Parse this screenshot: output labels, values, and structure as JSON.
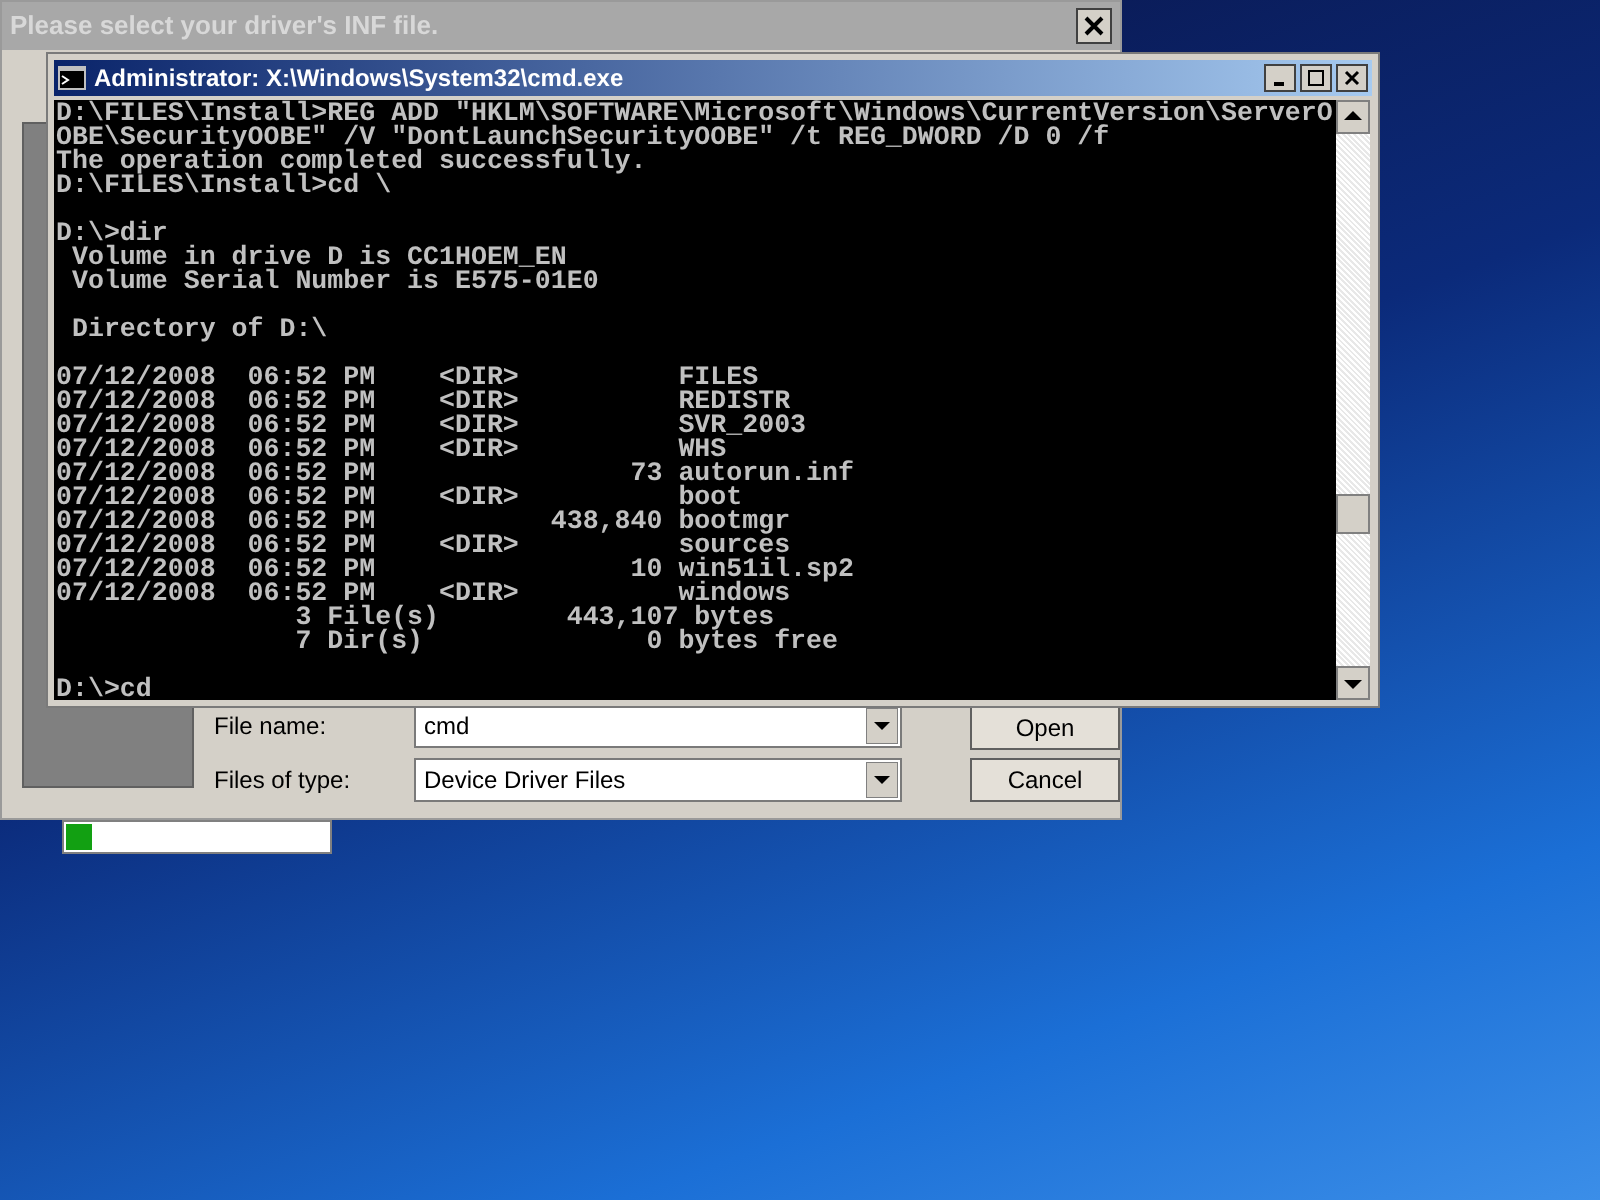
{
  "dialog": {
    "title": "Please select your driver's INF file.",
    "file_name": {
      "label": "File name:",
      "value": "cmd"
    },
    "file_type": {
      "label": "Files of type:",
      "value": "Device Driver Files"
    },
    "buttons": [
      "Open",
      "Cancel"
    ]
  },
  "progress": {
    "level": 0.1
  },
  "console": {
    "title": "Administrator: X:\\Windows\\System32\\cmd.exe",
    "lines": [
      {
        "kind": "text",
        "text": "D:\\FILES\\Install>REG ADD \"HKLM\\SOFTWARE\\Microsoft\\Windows\\CurrentVersion\\ServerO"
      },
      {
        "kind": "text",
        "text": "OBE\\SecurityOOBE\" /V \"DontLaunchSecurityOOBE\" /t REG_DWORD /D 0 /f"
      },
      {
        "kind": "text",
        "text": "The operation completed successfully."
      },
      {
        "kind": "text",
        "text": "D:\\FILES\\Install>cd \\"
      },
      {
        "kind": "blank"
      },
      {
        "kind": "text",
        "text": "D:\\>dir"
      },
      {
        "kind": "text",
        "text": " Volume in drive D is CC1HOEM_EN"
      },
      {
        "kind": "text",
        "text": " Volume Serial Number is E575-01E0"
      },
      {
        "kind": "blank"
      },
      {
        "kind": "text",
        "text": " Directory of D:\\"
      },
      {
        "kind": "blank"
      },
      {
        "kind": "text",
        "text": "07/12/2008  06:52 PM    <DIR>          FILES"
      },
      {
        "kind": "text",
        "text": "07/12/2008  06:52 PM    <DIR>          REDISTR"
      },
      {
        "kind": "text",
        "text": "07/12/2008  06:52 PM    <DIR>          SVR_2003"
      },
      {
        "kind": "text",
        "text": "07/12/2008  06:52 PM    <DIR>          WHS"
      },
      {
        "kind": "text",
        "text": "07/12/2008  06:52 PM                73 autorun.inf"
      },
      {
        "kind": "text",
        "text": "07/12/2008  06:52 PM    <DIR>          boot"
      },
      {
        "kind": "text",
        "text": "07/12/2008  06:52 PM           438,840 bootmgr"
      },
      {
        "kind": "text",
        "text": "07/12/2008  06:52 PM    <DIR>          sources"
      },
      {
        "kind": "text",
        "text": "07/12/2008  06:52 PM                10 win51il.sp2"
      },
      {
        "kind": "text",
        "text": "07/12/2008  06:52 PM    <DIR>          windows"
      },
      {
        "kind": "text",
        "text": "               3 File(s)        443,107 bytes"
      },
      {
        "kind": "text",
        "text": "               7 Dir(s)              0 bytes free"
      },
      {
        "kind": "blank"
      },
      {
        "kind": "text",
        "text": "D:\\>cd"
      }
    ]
  }
}
